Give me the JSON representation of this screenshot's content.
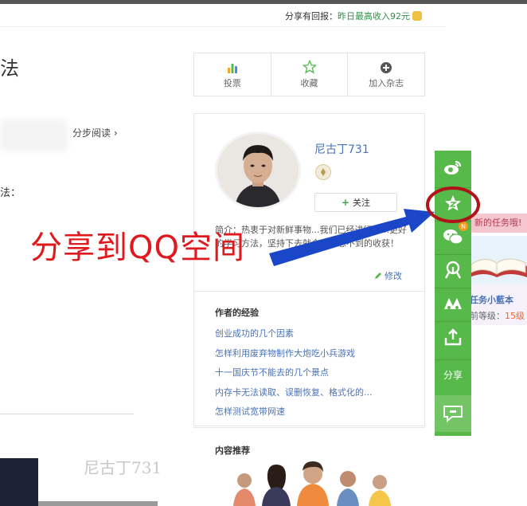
{
  "share_bar": {
    "prefix": "分享有回报：",
    "highlight": "昨日最高收入92元"
  },
  "left": {
    "title_char": "法",
    "step_link": "分步阅读 ›",
    "method_label": "法：",
    "watermark": "尼古丁731"
  },
  "actions": [
    {
      "label": "投票",
      "icon": "bar-chart-icon"
    },
    {
      "label": "收藏",
      "icon": "star-outline-icon"
    },
    {
      "label": "加入杂志",
      "icon": "plus-circle-icon"
    }
  ],
  "author": {
    "name": "尼古丁731",
    "follow_label": "关注",
    "bio": "简介：热衷于对新鲜事物...我们已经进行了...更好的学习方法，坚持下去就会有意想不到的收获！",
    "edit_label": "修改"
  },
  "experience": {
    "heading": "作者的经验",
    "items": [
      "创业成功的几个因素",
      "怎样利用废弃物制作大炮吃小兵游戏",
      "十一国庆节不能去的几个景点",
      "内存卡无法读取、误删恢复、格式化的...",
      "怎样测试宽带网速"
    ]
  },
  "recommend": {
    "heading": "内容推荐"
  },
  "share_sidebar": {
    "items": [
      "weibo-icon",
      "qzone-star-icon",
      "wechat-icon",
      "renren-icon",
      "kaixin-icon",
      "share-arrow-icon"
    ],
    "share_label": "分享",
    "new_badge": "N"
  },
  "task_panel": {
    "banner": "新的任务哦!",
    "title": "任务小藍本",
    "level_prefix": "前等级：",
    "level_value": "15级"
  },
  "annotation": {
    "text": "分享到QQ空间",
    "color": "#e0191e",
    "arrow_color": "#1a46c8",
    "circle_color": "#b0141a"
  },
  "colors": {
    "sidebar_green": "#58b94b",
    "link_blue": "#4a72b8"
  }
}
